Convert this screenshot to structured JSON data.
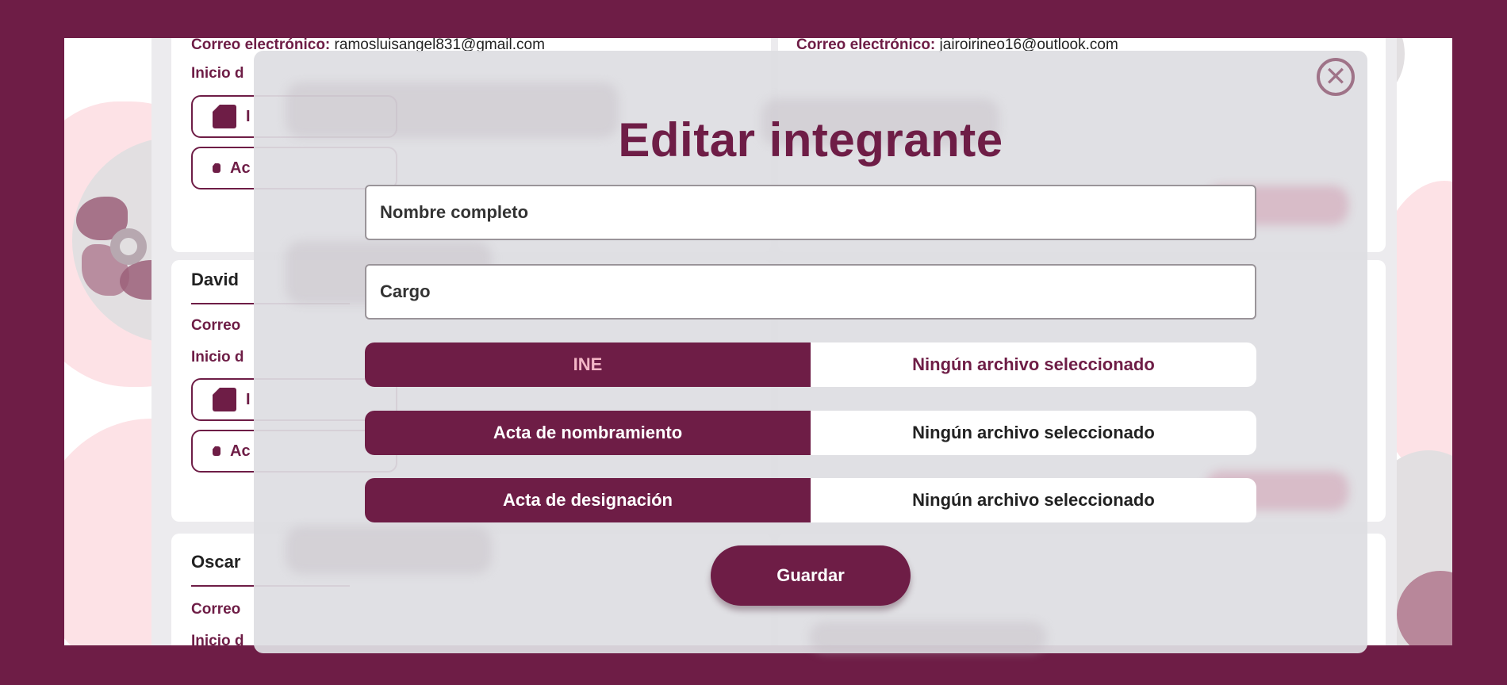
{
  "background_cards": {
    "left_email_label": "Correo electrónico:",
    "left_email_value": " ramosluisangel831@gmail.com",
    "right_email_label": "Correo electrónico:",
    "right_email_value": " jairoirineo16@outlook.com",
    "inicio_label_1": "Inicio d",
    "doc_btn_1": "I",
    "doc_btn_2": "Ac",
    "member_2_name": "David",
    "member_2_email_label": "Correo",
    "inicio_label_2": "Inicio d",
    "doc_btn_3": "I",
    "doc_btn_4": "Ac",
    "member_3_name": "Oscar",
    "member_3_email_label": "Correo",
    "inicio_label_3": "Inicio d"
  },
  "modal": {
    "title": "Editar integrante",
    "close_symbol": "✕",
    "name_placeholder": "Nombre completo",
    "cargo_placeholder": "Cargo",
    "files": [
      {
        "button": "INE",
        "status": "Ningún archivo seleccionado"
      },
      {
        "button": "Acta de nombramiento",
        "status": "Ningún archivo seleccionado"
      },
      {
        "button": "Acta de designación",
        "status": "Ningún archivo seleccionado"
      }
    ],
    "save_label": "Guardar"
  },
  "colors": {
    "brand": "#6e1d46",
    "accent_pink": "#f3b6c6",
    "overlay": "#dededf"
  },
  "icons": [
    "close-icon",
    "document-icon"
  ]
}
